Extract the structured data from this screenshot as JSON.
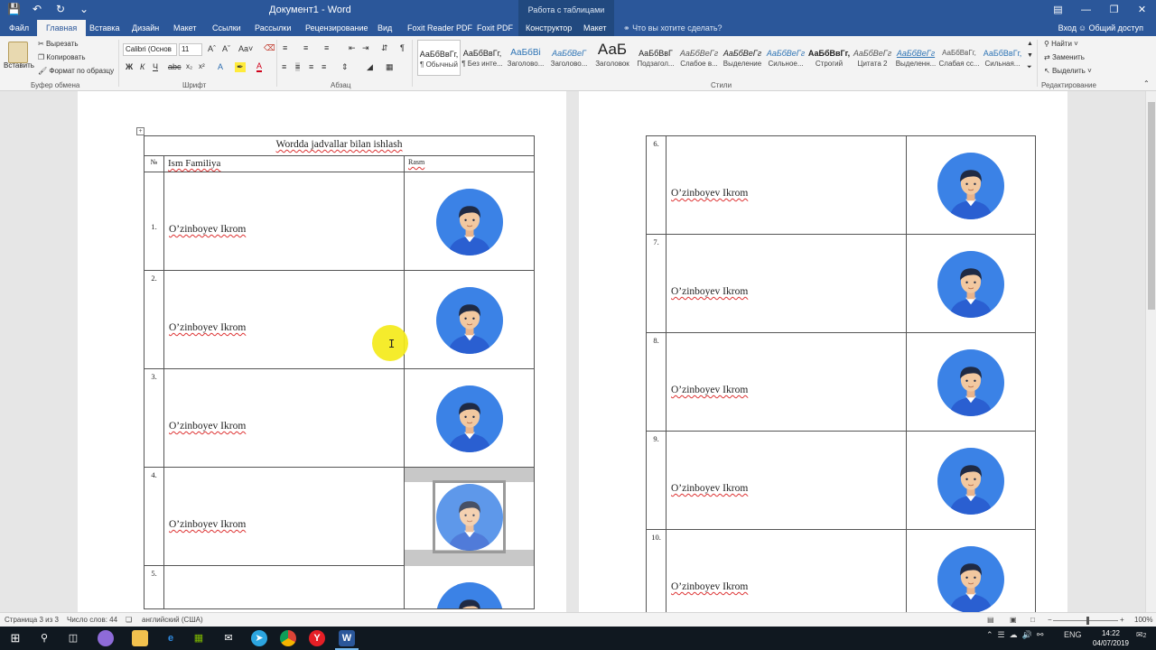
{
  "titlebar": {
    "doc_title": "Документ1 - Word",
    "context_group": "Работа с таблицами"
  },
  "tabs": {
    "file": "Файл",
    "home": "Главная",
    "insert": "Вставка",
    "design": "Дизайн",
    "layout": "Макет",
    "references": "Ссылки",
    "mailings": "Рассылки",
    "review": "Рецензирование",
    "view": "Вид",
    "foxit_reader": "Foxit Reader PDF",
    "foxit": "Foxit PDF",
    "constructor": "Конструктор",
    "table_layout": "Макет",
    "tell_me": "Что вы хотите сделать?",
    "sign_in": "Вход",
    "share": "Общий доступ"
  },
  "ribbon": {
    "paste": "Вставить",
    "cut": "Вырезать",
    "copy": "Копировать",
    "format_painter": "Формат по образцу",
    "clipboard_group": "Буфер обмена",
    "font_name": "Calibri (Основ",
    "font_size": "11",
    "font_group": "Шрифт",
    "paragraph_group": "Абзац",
    "styles_group": "Стили",
    "editing_group": "Редактирование",
    "find": "Найти",
    "replace": "Заменить",
    "select": "Выделить",
    "styles": [
      {
        "sample": "АаБбВвГг,",
        "name": "¶ Обычный"
      },
      {
        "sample": "АаБбВвГг,",
        "name": "¶ Без инте..."
      },
      {
        "sample": "АаБбВі",
        "name": "Заголово..."
      },
      {
        "sample": "АаБбВеГ",
        "name": "Заголово..."
      },
      {
        "sample": "АаБ",
        "name": "Заголовок"
      },
      {
        "sample": "АаБбВвГ",
        "name": "Подзагол..."
      },
      {
        "sample": "АаБбВеГг",
        "name": "Слабое в..."
      },
      {
        "sample": "АаБбВеГг",
        "name": "Выделение"
      },
      {
        "sample": "АаБбВеГг",
        "name": "Сильное..."
      },
      {
        "sample": "АаБбВвГг,",
        "name": "Строгий"
      },
      {
        "sample": "АаБбВеГг",
        "name": "Цитата 2"
      },
      {
        "sample": "АаБбВеГг",
        "name": "Выделенн..."
      },
      {
        "sample": "АаБбВвГг,",
        "name": "Слабая сс..."
      },
      {
        "sample": "АаБбВвГг,",
        "name": "Сильная..."
      }
    ]
  },
  "document": {
    "table_title": "Wordda jadvallar bilan ishlash",
    "col_num": "№",
    "col_name": "Ism Familiya",
    "col_pic": "Rasm",
    "rows_page1": [
      {
        "num": "1.",
        "name": "O’zinboyev Ikrom"
      },
      {
        "num": "2.",
        "name": "O’zinboyev Ikrom"
      },
      {
        "num": "3.",
        "name": "O’zinboyev Ikrom"
      },
      {
        "num": "4.",
        "name": "O’zinboyev Ikrom"
      },
      {
        "num": "5.",
        "name": ""
      }
    ],
    "rows_page2": [
      {
        "num": "6.",
        "name": "O’zinboyev Ikrom"
      },
      {
        "num": "7.",
        "name": "O’zinboyev Ikrom"
      },
      {
        "num": "8.",
        "name": "O’zinboyev Ikrom"
      },
      {
        "num": "9.",
        "name": "O’zinboyev Ikrom"
      },
      {
        "num": "10.",
        "name": "O’zinboyev Ikrom"
      }
    ]
  },
  "statusbar": {
    "page": "Страница 3 из 3",
    "words": "Число слов: 44",
    "language": "английский (США)",
    "zoom": "100%"
  },
  "taskbar": {
    "lang": "ENG",
    "time": "14:22",
    "date": "04/07/2019",
    "notifications": "2"
  },
  "colors": {
    "word_blue": "#2b579a",
    "avatar_blue": "#3b82e6",
    "avatar_shirt": "#2a5fd1",
    "highlight_yellow": "#f4ea1a"
  }
}
